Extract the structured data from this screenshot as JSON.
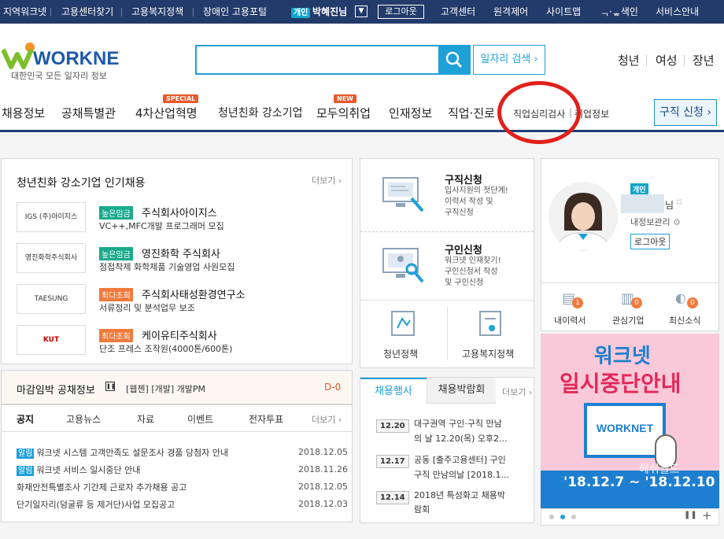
{
  "topbar": {
    "links": [
      "지역워크넷",
      "고용센터찾기",
      "고용복지정책",
      "장애인 고용포털"
    ],
    "user_badge": "개인",
    "user_name": "박혜진님",
    "logout": "로그아웃",
    "right_links": [
      "고객센터",
      "원격제어",
      "사이트맵",
      "ᆨ·ᇂ색인",
      "서비스안내"
    ]
  },
  "header": {
    "logo": "WORKNET",
    "logo_sub": "대한민국 모든 일자리 정보",
    "search_placeholder": "",
    "job_search": "일자리 검색",
    "user_links": [
      "청년",
      "여성",
      "장년"
    ]
  },
  "nav": {
    "items": [
      "채용정보",
      "공채특별관",
      "4차산업혁명",
      "청년친화 강소기업",
      "모두의취업",
      "인재정보",
      "직업·진로"
    ],
    "small_items": [
      "직업심리검사",
      "취업정보"
    ],
    "tags": {
      "special": "SPECIAL",
      "new": "NEW"
    },
    "apply": "구직 신청"
  },
  "popular": {
    "title": "청년친화 강소기업 인기채용",
    "more": "더보기",
    "companies": [
      {
        "logo": "IGS (주)아이지스",
        "tag": "높은임금",
        "tag_color": "#1aaa8c",
        "name": "주식회사아이지스",
        "desc": "VC++,MFC개발 프로그래머 모집"
      },
      {
        "logo": "영진화학주식회사",
        "tag": "높은임금",
        "tag_color": "#1aaa8c",
        "name": "영진화학 주식회사",
        "desc": "점접착제 화학제품 기술영업 사원모집"
      },
      {
        "logo": "TAESUNG",
        "tag": "최다조회",
        "tag_color": "#f07a3c",
        "name": "주식회사태성환경연구소",
        "desc": "서류정리 및 분석업무 보조"
      },
      {
        "logo": "KUT",
        "tag": "최다조회",
        "tag_color": "#f07a3c",
        "name": "케이유티주식회사",
        "desc": "단조 프레스 조작원(4000톤/600톤)"
      }
    ]
  },
  "deadline": {
    "title": "마감임박 공채정보",
    "text": "[웹젠] [개발] 개발PM",
    "dday": "D-0"
  },
  "notices": {
    "tabs": [
      "공지",
      "고용뉴스",
      "자료",
      "이벤트",
      "전자투표"
    ],
    "more": "더보기",
    "items": [
      {
        "badge": "알림",
        "text": "워크넷 시스템 고객만족도 설문조사 경품 당첨자 안내",
        "date": "2018.12.05"
      },
      {
        "badge": "알림",
        "text": "워크넷 서비스 일시중단 안내",
        "date": "2018.11.26"
      },
      {
        "badge": "",
        "text": "화재안전특별조사 기간제 근로자 추가채용 공고",
        "date": "2018.12.05"
      },
      {
        "badge": "",
        "text": "단기일자리(덩굴류 등 제거단)사업 모집공고",
        "date": "2018.12.03"
      }
    ]
  },
  "services": [
    {
      "title": "구직신청",
      "desc": [
        "입사지원의 첫단계!",
        "이력서 작성 및",
        "구직신청"
      ]
    },
    {
      "title": "구인신청",
      "desc": [
        "워크넷 인재찾기!",
        "구인신청서 작성",
        "및 구인신청"
      ]
    }
  ],
  "policies": [
    "청년정책",
    "고용복지정책"
  ],
  "events": {
    "tabs": [
      "채용행사",
      "채용박람회"
    ],
    "more": "더보기",
    "items": [
      {
        "date": "12.20",
        "lines": [
          "대구권역 구인·구직 만남",
          "의 날 12.20(목) 오후2..."
        ]
      },
      {
        "date": "12.17",
        "lines": [
          "공동 [출주고용센터] 구인",
          "구직 만남의날 [2018.1..."
        ]
      },
      {
        "date": "12.14",
        "lines": [
          "2018년 특성화고 채용박",
          "람회"
        ]
      }
    ]
  },
  "profile": {
    "badge": "개인",
    "suffix": "님",
    "info": "내정보관리",
    "logout": "로그아웃",
    "quick": [
      {
        "label": "내이력서",
        "count": "1"
      },
      {
        "label": "관심기업",
        "count": "0"
      },
      {
        "label": "최신소식",
        "count": "0"
      }
    ]
  },
  "banner": {
    "title1": "워크넷",
    "title2": "일시중단안내",
    "logo": "WORKNET",
    "dates": "'18.12.7 ~ '18.12.10",
    "overlay": "헤쉬월드"
  },
  "colors": {
    "topbar": "#233b6a",
    "accent": "#1ea0d8",
    "nav_border": "#1e3f78",
    "highlight_circle": "#e2201a"
  }
}
